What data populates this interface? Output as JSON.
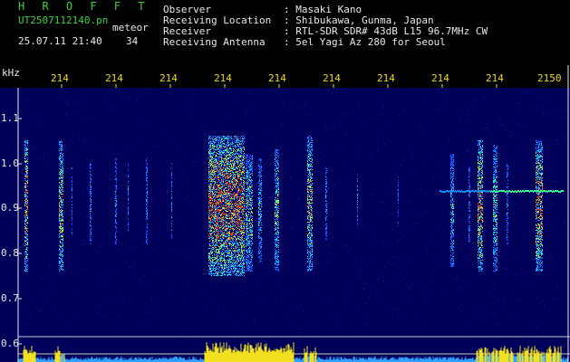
{
  "header": {
    "program": "H R O F F T",
    "filename": "UT2507112140.pn",
    "meteor_label": "meteor",
    "datetime": "25.07.11 21:40",
    "count": "34"
  },
  "station": {
    "labels": [
      "Observer",
      "Receiving Location",
      "Receiver",
      "Receiving Antenna"
    ],
    "values": [
      ": Masaki Kano",
      ": Shibukawa, Gunma, Japan",
      ": RTL-SDR SDR# 43dB L15 96.7MHz CW",
      ": 5el Yagi Az 280 for Seoul"
    ]
  },
  "axes": {
    "y_unit": "kHz",
    "y_ticks": [
      "1.1",
      "1.0",
      "0.9",
      "0.8",
      "0.7",
      "0.6"
    ],
    "x_ticks": [
      "214",
      "214",
      "214",
      "214",
      "214",
      "214",
      "214",
      "214",
      "214",
      "2150"
    ]
  },
  "colors": {
    "background": "#000000",
    "plot_bg": "#00005a",
    "title_green": "#3cd23c",
    "tick_yellow": "#e8d820",
    "text_white": "#e8e8e8"
  }
}
